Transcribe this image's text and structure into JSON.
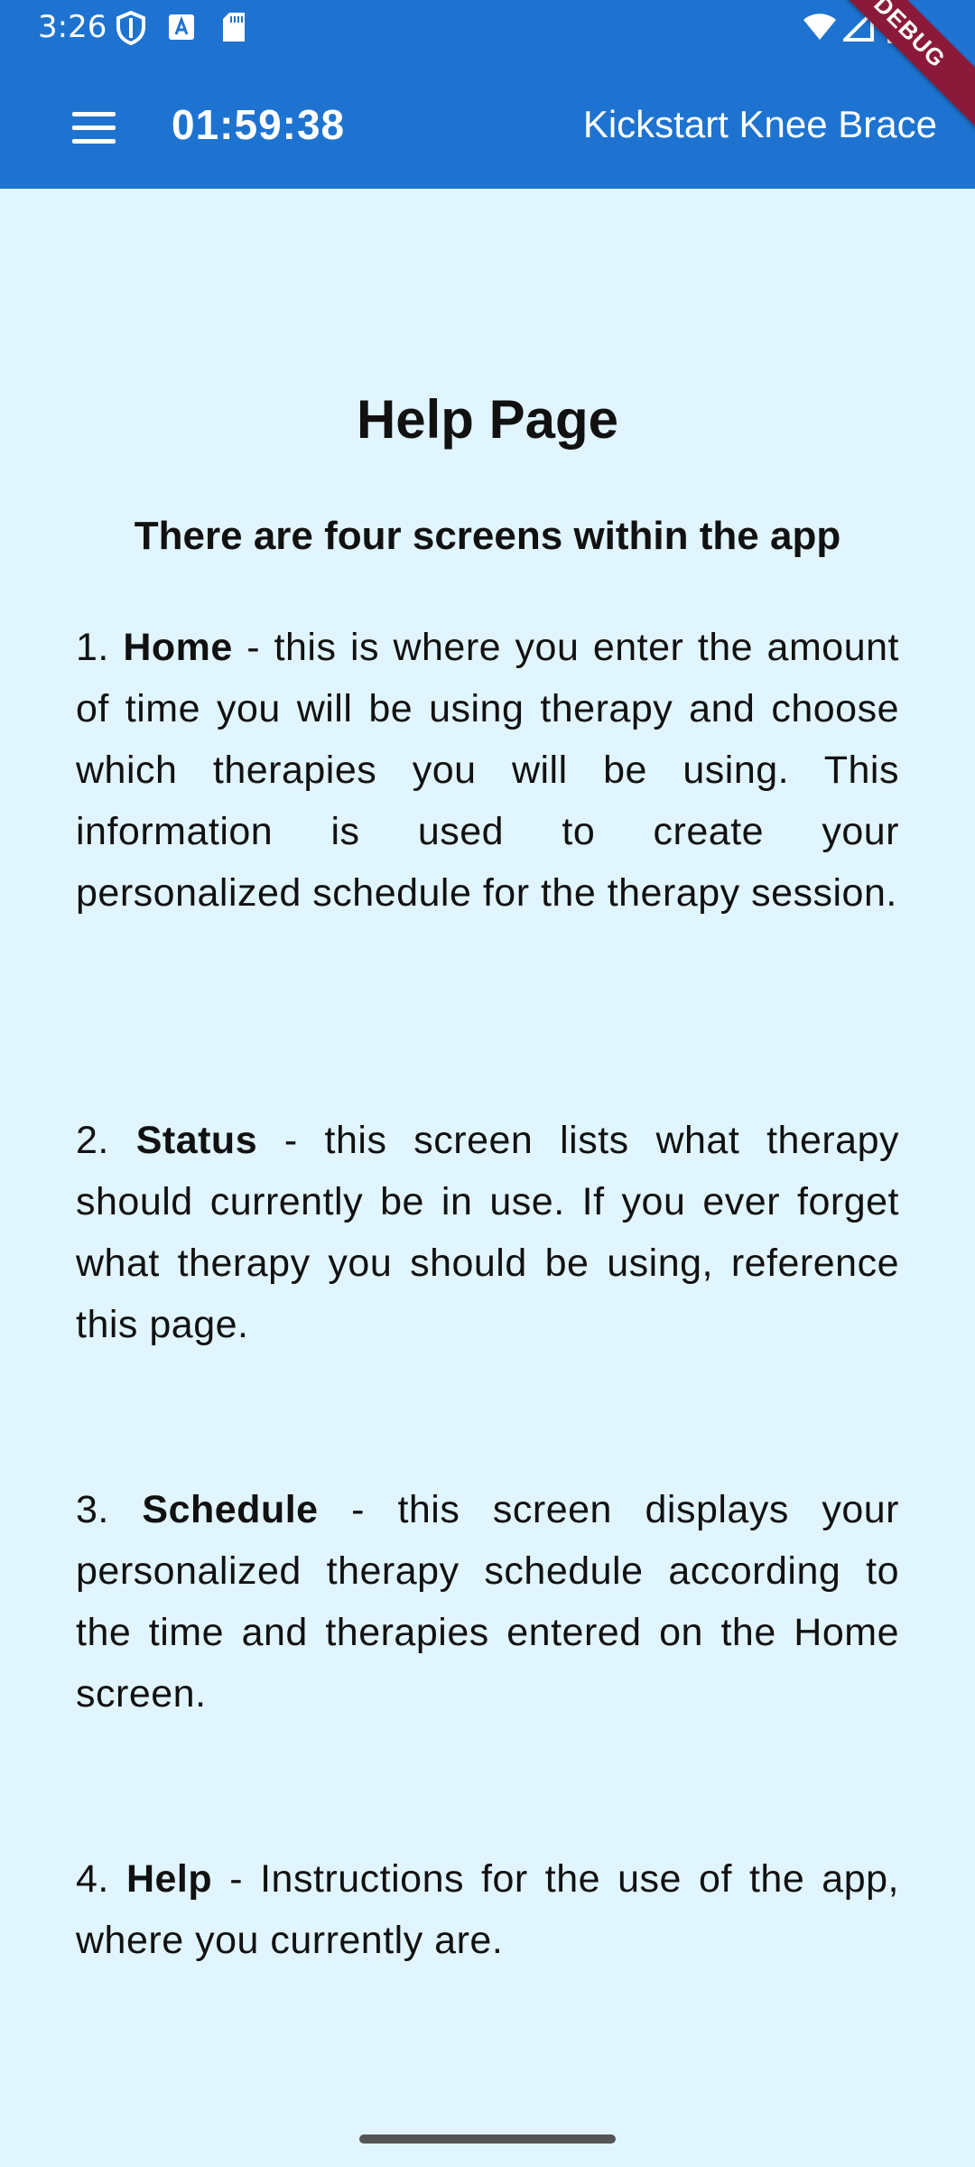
{
  "status_bar": {
    "time": "3:26",
    "icons": [
      "shield-icon",
      "font-a-icon",
      "sd-card-icon",
      "wifi-icon",
      "signal-icon",
      "battery-icon"
    ]
  },
  "debug_banner": "DEBUG",
  "app_bar": {
    "menu_icon": "hamburger-menu-icon",
    "timer": "01:59:38",
    "title": "Kickstart Knee Brace"
  },
  "page": {
    "heading": "Help Page",
    "subheading": "There are four screens within the app",
    "items": [
      {
        "number": "1.",
        "name": "Home",
        "description": "- this is where you enter the amount of time you will be using therapy and choose which therapies you will be using. This information is used to create your personalized schedule for the therapy session."
      },
      {
        "number": "2.",
        "name": "Status",
        "description": "- this screen lists what therapy should currently be in use. If you ever forget what therapy you should be using, reference this page."
      },
      {
        "number": "3.",
        "name": "Schedule",
        "description": "- this screen displays your personalized therapy schedule according to the time and therapies entered on the Home screen."
      },
      {
        "number": "4.",
        "name": "Help",
        "description": "- Instructions for the use of the app, where you currently are."
      }
    ]
  },
  "colors": {
    "app_bar": "#1e73d0",
    "background": "#e1f5fe",
    "debug_banner": "#8b1a3a"
  }
}
